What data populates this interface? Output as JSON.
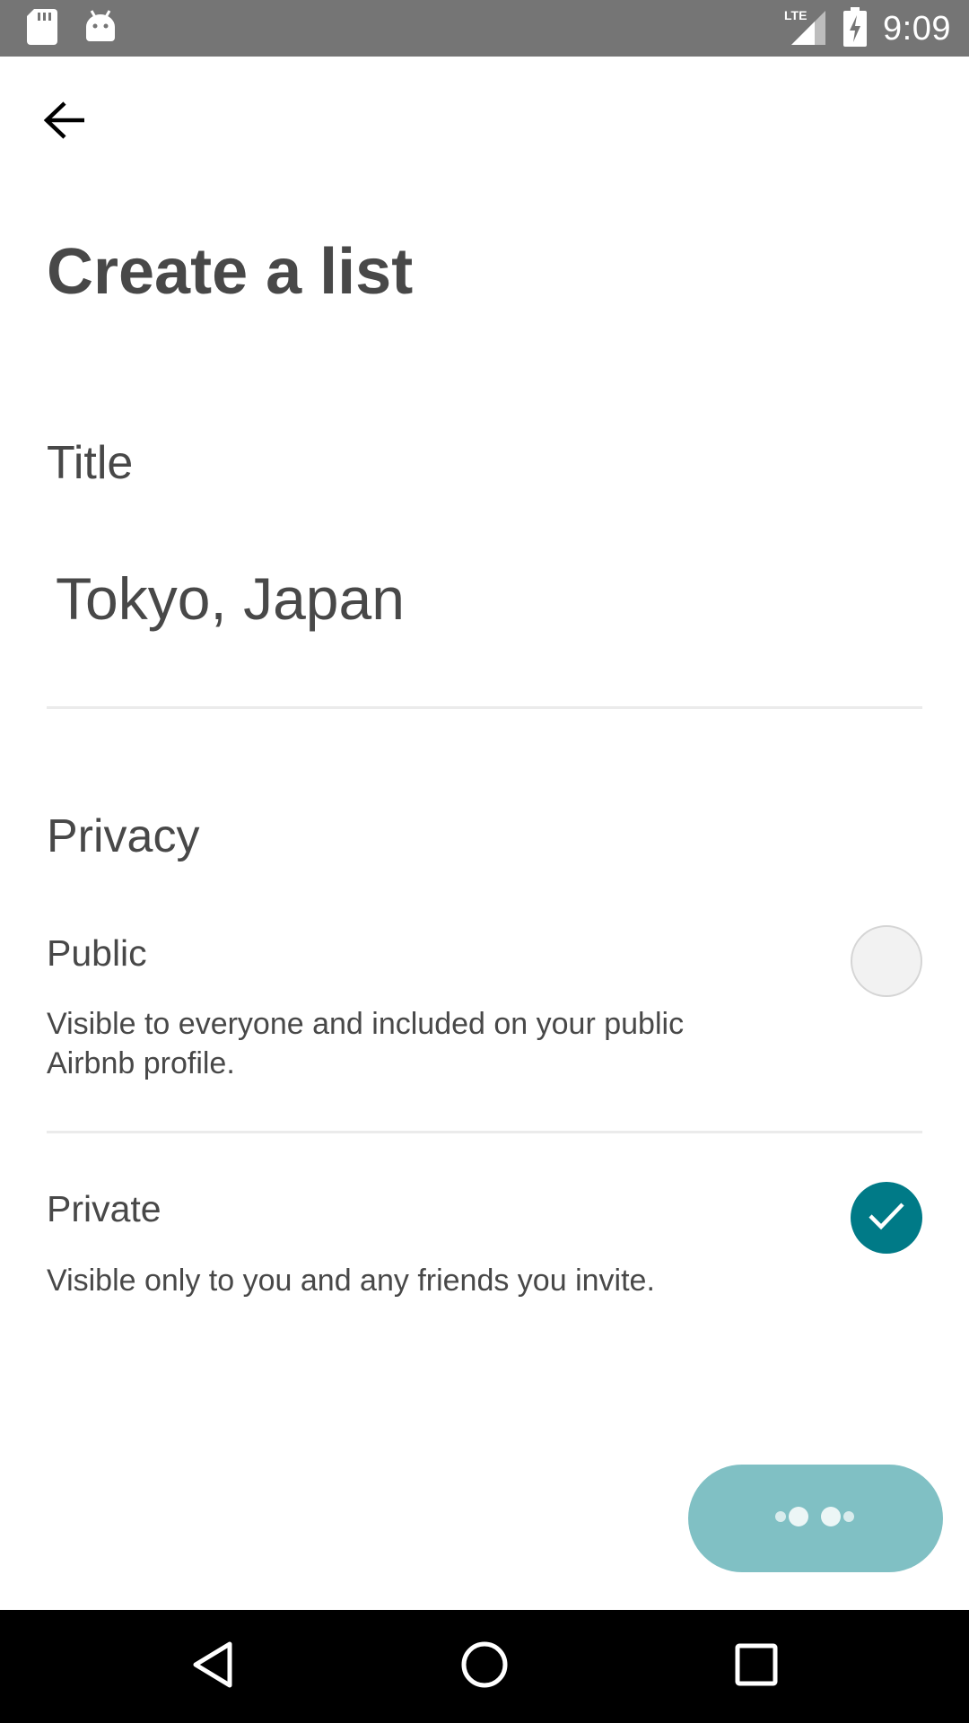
{
  "status_bar": {
    "time": "9:09",
    "network": "LTE",
    "left_icons": [
      "sd-card-icon",
      "android-icon"
    ],
    "right_icons": [
      "lte-signal-icon",
      "battery-charging-icon"
    ]
  },
  "header": {
    "back_icon": "arrow-left-icon",
    "title": "Create a list"
  },
  "form": {
    "title_label": "Title",
    "title_value": "Tokyo, Japan",
    "privacy_label": "Privacy",
    "options": [
      {
        "label": "Public",
        "description": "Visible to everyone and included on your public Airbnb profile.",
        "selected": false
      },
      {
        "label": "Private",
        "description": "Visible only to you and any friends you invite.",
        "selected": true
      }
    ]
  },
  "next_button": {
    "state": "loading",
    "icon": "loading-dots-icon"
  },
  "nav_bar": {
    "buttons": [
      "back-triangle-icon",
      "home-circle-icon",
      "recents-square-icon"
    ]
  },
  "colors": {
    "accent": "#007a87",
    "button_loading": "#80c0c4",
    "text": "#484848",
    "status_bar": "#757575"
  }
}
